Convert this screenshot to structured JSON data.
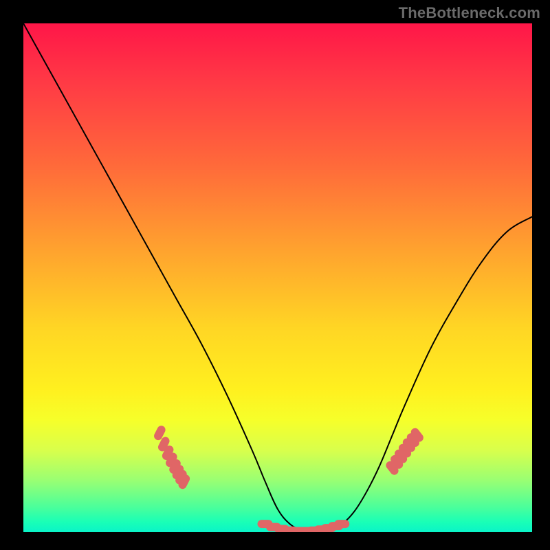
{
  "watermark": "TheBottleneck.com",
  "chart_data": {
    "type": "line",
    "title": "",
    "xlabel": "",
    "ylabel": "",
    "xlim": [
      0,
      100
    ],
    "ylim": [
      0,
      100
    ],
    "grid": false,
    "legend": false,
    "series": [
      {
        "name": "bottleneck-curve",
        "x": [
          0,
          5,
          10,
          15,
          20,
          25,
          30,
          35,
          40,
          45,
          47.5,
          50,
          52.5,
          55,
          57.5,
          60,
          62.5,
          65,
          67.5,
          70,
          72.5,
          75,
          80,
          85,
          90,
          95,
          100
        ],
        "y": [
          100,
          91,
          82,
          73,
          64,
          55,
          46,
          37,
          27,
          16,
          10,
          4.5,
          1.5,
          0.3,
          0,
          0.4,
          1.5,
          4,
          8,
          13,
          19,
          25,
          36,
          45,
          53,
          59,
          62
        ],
        "stroke": "#000000",
        "stroke_width": 2
      }
    ],
    "markers": [
      {
        "name": "left-cluster",
        "color": "#e06666",
        "points": [
          {
            "x": 26.8,
            "y": 19.5
          },
          {
            "x": 27.6,
            "y": 17.3
          },
          {
            "x": 28.4,
            "y": 15.6
          },
          {
            "x": 29.1,
            "y": 14.2
          },
          {
            "x": 29.8,
            "y": 12.9
          },
          {
            "x": 30.4,
            "y": 11.8
          },
          {
            "x": 31.0,
            "y": 10.8
          },
          {
            "x": 31.6,
            "y": 9.9
          }
        ],
        "elongated": true,
        "rotation_deg": -63
      },
      {
        "name": "valley-cluster",
        "color": "#e06666",
        "points": [
          {
            "x": 47.5,
            "y": 1.6
          },
          {
            "x": 49.2,
            "y": 1.0
          },
          {
            "x": 50.8,
            "y": 0.6
          },
          {
            "x": 52.4,
            "y": 0.3
          },
          {
            "x": 54.0,
            "y": 0.2
          },
          {
            "x": 55.6,
            "y": 0.2
          },
          {
            "x": 57.2,
            "y": 0.3
          },
          {
            "x": 58.6,
            "y": 0.5
          },
          {
            "x": 60.0,
            "y": 0.8
          },
          {
            "x": 61.4,
            "y": 1.2
          },
          {
            "x": 62.6,
            "y": 1.6
          }
        ],
        "elongated": true,
        "rotation_deg": 0
      },
      {
        "name": "right-cluster",
        "color": "#e06666",
        "points": [
          {
            "x": 72.5,
            "y": 12.6
          },
          {
            "x": 73.4,
            "y": 13.8
          },
          {
            "x": 74.2,
            "y": 14.9
          },
          {
            "x": 75.0,
            "y": 16.0
          },
          {
            "x": 75.8,
            "y": 17.1
          },
          {
            "x": 76.6,
            "y": 18.1
          },
          {
            "x": 77.4,
            "y": 19.1
          }
        ],
        "elongated": true,
        "rotation_deg": 52
      }
    ],
    "annotations": []
  }
}
